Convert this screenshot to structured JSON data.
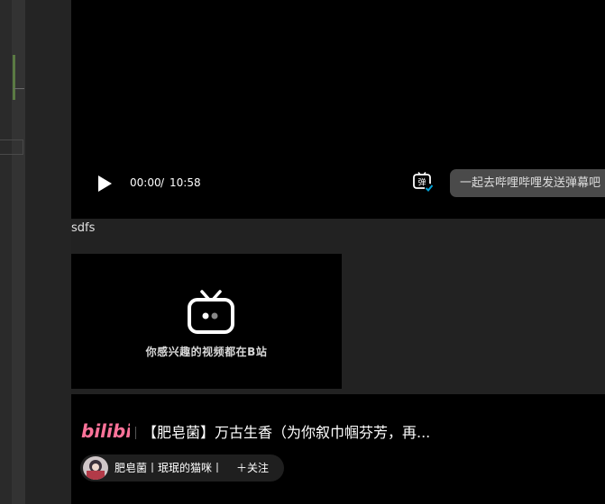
{
  "player": {
    "current_time": "00:00",
    "separator": "/",
    "duration": "10:58",
    "danmaku_icon_glyph": "弹",
    "danmaku_placeholder": "一起去哔哩哔哩发送弹幕吧",
    "play_icon": "play-icon",
    "danmaku_icon": "danmaku-toggle-icon"
  },
  "caption": "sdfs",
  "embed": {
    "hint": "你感兴趣的视频都在B站",
    "icon": "tv-icon"
  },
  "card": {
    "logo": "bilibili",
    "title": "【肥皂菌】万古生香（为你叙巾帼芬芳，再...",
    "author": "肥皂菌丨珉珉的猫咪丨",
    "follow": "＋关注",
    "accent": "#fb7299"
  }
}
